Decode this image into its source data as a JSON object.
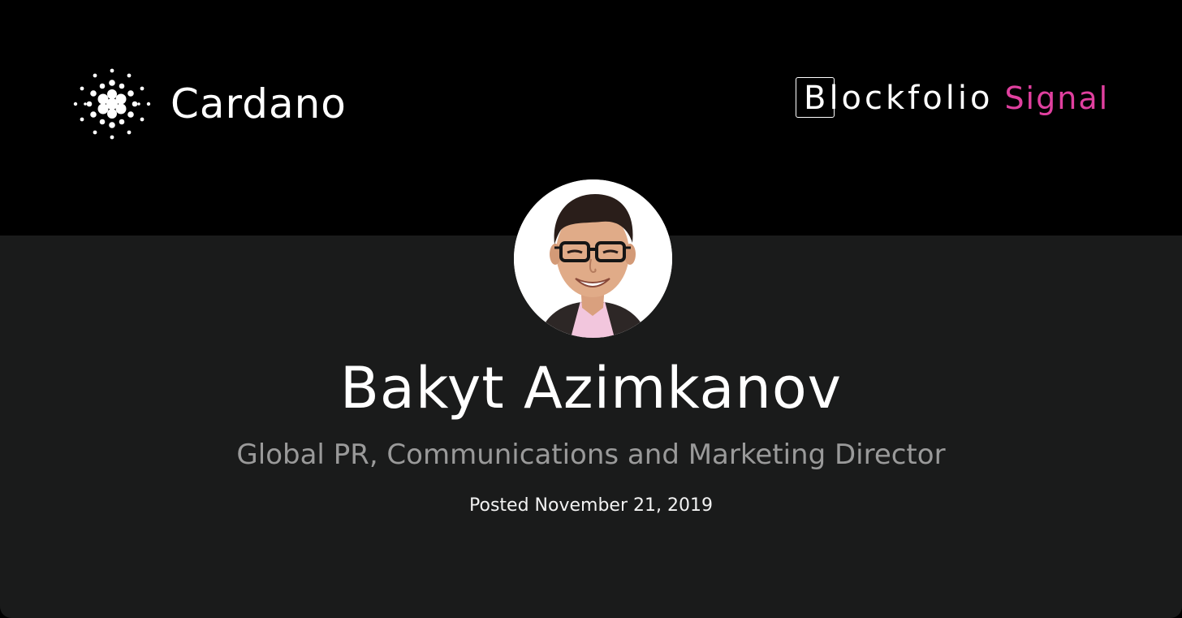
{
  "logos": {
    "left": {
      "name": "Cardano",
      "icon": "cardano-logo-icon"
    },
    "right": {
      "brand": "Blockfolio",
      "suffix": "Signal",
      "suffix_color": "#e0409f"
    }
  },
  "profile": {
    "name": "Bakyt Azimkanov",
    "role": "Global PR, Communications and Marketing Director",
    "posted": "Posted November 21, 2019",
    "avatar_icon": "profile-photo"
  },
  "colors": {
    "top_band": "#000000",
    "panel": "#1a1b1b",
    "role_text": "#9a9a9a",
    "accent": "#e0409f"
  }
}
